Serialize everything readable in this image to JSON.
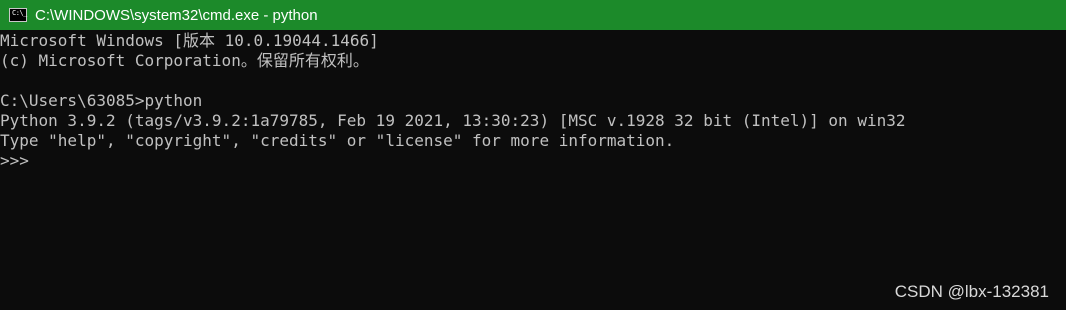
{
  "window": {
    "icon_text": "C:\\_",
    "title": "C:\\WINDOWS\\system32\\cmd.exe - python",
    "titlebar_color": "#1c8a2a",
    "background_color": "#0c0c0c",
    "text_color": "#c0c0c0"
  },
  "console": {
    "lines": [
      "Microsoft Windows [版本 10.0.19044.1466]",
      "(c) Microsoft Corporation。保留所有权利。",
      "",
      "C:\\Users\\63085>python",
      "Python 3.9.2 (tags/v3.9.2:1a79785, Feb 19 2021, 13:30:23) [MSC v.1928 32 bit (Intel)] on win32",
      "Type \"help\", \"copyright\", \"credits\" or \"license\" for more information.",
      ">>>"
    ]
  },
  "watermark": {
    "text": "CSDN @lbx-132381"
  }
}
